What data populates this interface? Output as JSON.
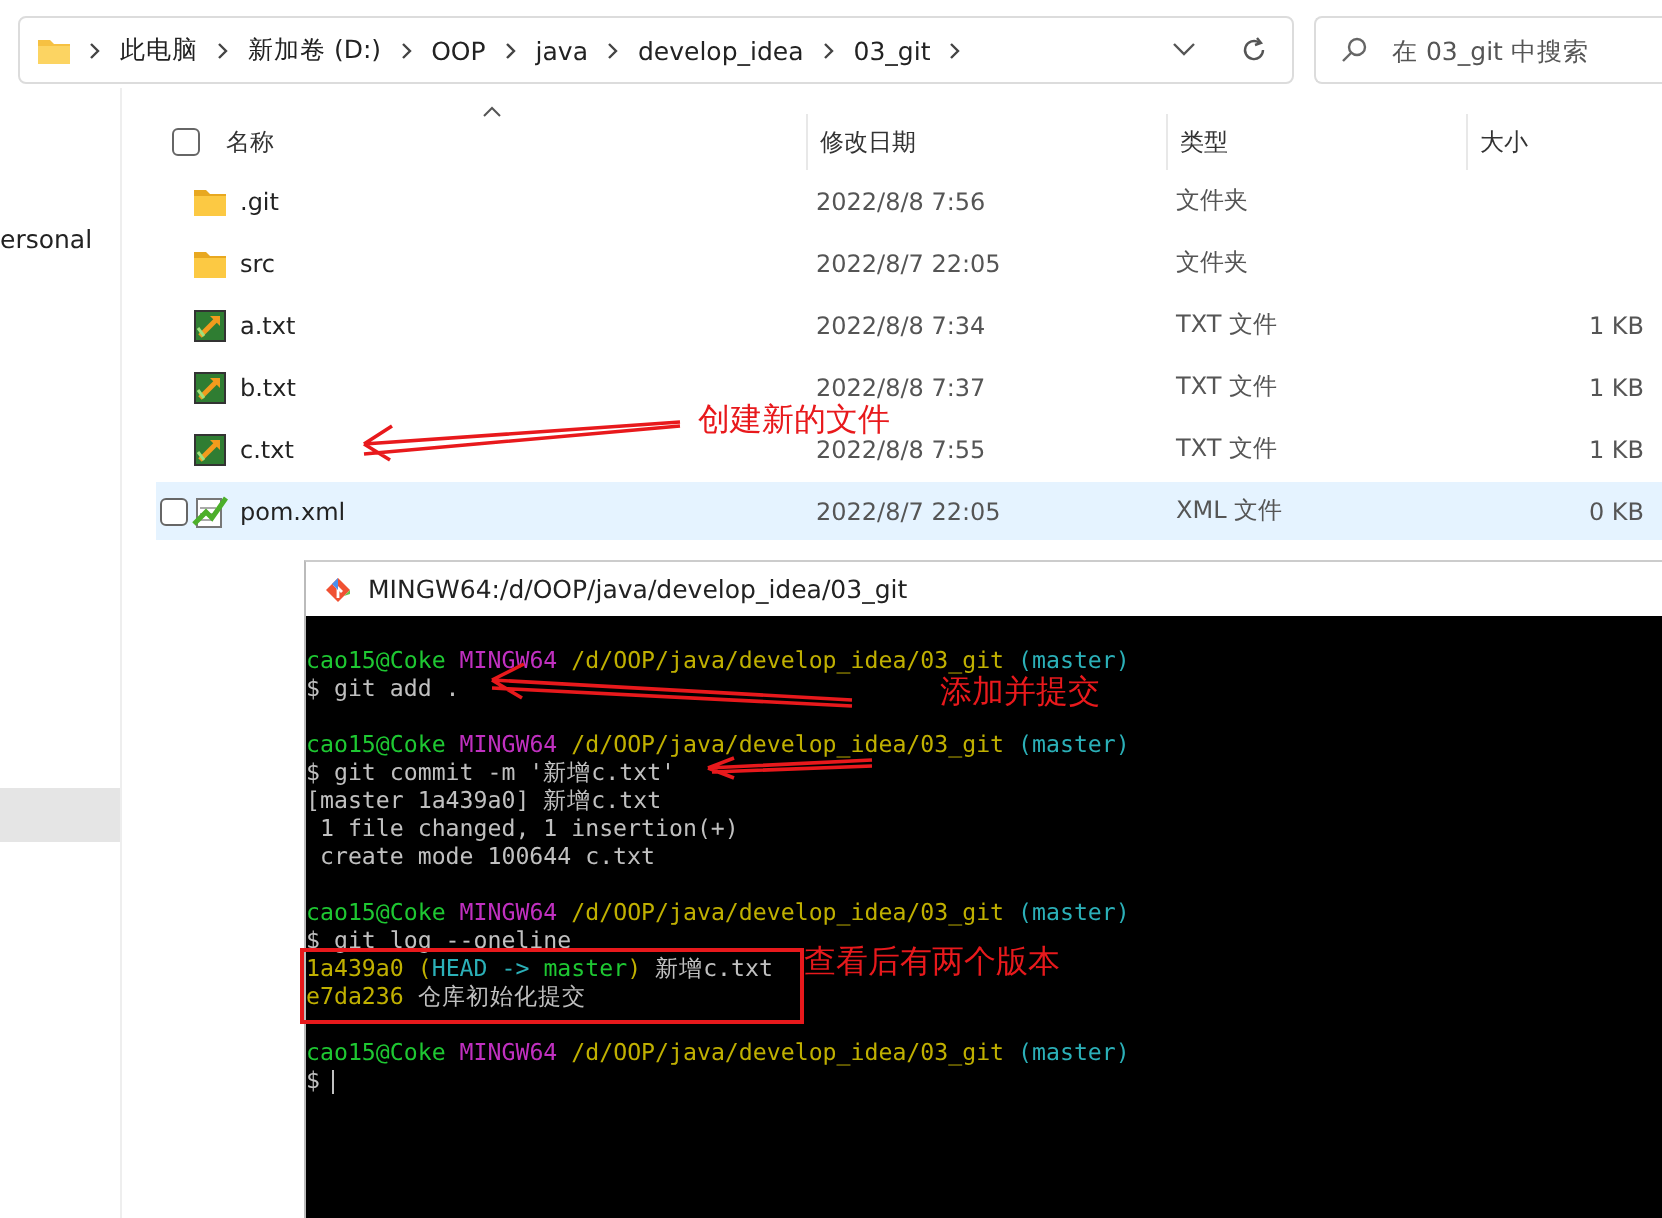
{
  "address_bar": {
    "crumbs": [
      "此电脑",
      "新加卷 (D:)",
      "OOP",
      "java",
      "develop_idea",
      "03_git"
    ]
  },
  "search": {
    "placeholder": "在 03_git 中搜索"
  },
  "nav_pane": {
    "items": [
      {
        "label": "ersonal",
        "selected": false
      },
      {
        "selected": true
      }
    ]
  },
  "file_list": {
    "select_all": {
      "checked": false
    },
    "columns": [
      "名称",
      "修改日期",
      "类型",
      "大小"
    ],
    "rows": [
      {
        "kind": "folder",
        "name": ".git",
        "date": "2022/8/8 7:56",
        "type": "文件夹",
        "hovered": false,
        "checked": false
      },
      {
        "kind": "folder",
        "name": "src",
        "date": "2022/8/7 22:05",
        "type": "文件夹",
        "hovered": false,
        "checked": false
      },
      {
        "kind": "git-file",
        "name": "a.txt",
        "date": "2022/8/8 7:34",
        "type": "TXT 文件",
        "size": "1 KB",
        "hovered": false,
        "checked": false
      },
      {
        "kind": "git-file",
        "name": "b.txt",
        "date": "2022/8/8 7:37",
        "type": "TXT 文件",
        "size": "1 KB",
        "hovered": false,
        "checked": false
      },
      {
        "kind": "git-file",
        "name": "c.txt",
        "date": "2022/8/8 7:55",
        "type": "TXT 文件",
        "size": "1 KB",
        "hovered": false,
        "checked": false
      },
      {
        "kind": "xml-file",
        "name": "pom.xml",
        "date": "2022/8/7 22:05",
        "type": "XML 文件",
        "size": "0 KB",
        "hovered": true,
        "checked": false
      }
    ]
  },
  "terminal": {
    "title": "MINGW64:/d/OOP/java/develop_idea/03_git",
    "lines": [
      {
        "kind": "text",
        "segments": [
          {
            "kind": "user",
            "text": "cao15@Coke"
          },
          {
            "kind": "host",
            "text": "MINGW64"
          },
          {
            "kind": "path",
            "text": "/d/OOP/java/develop_idea/03_git"
          },
          {
            "kind": "branch",
            "text": "(master)"
          }
        ]
      },
      {
        "kind": "text",
        "segments": [
          {
            "kind": "plain",
            "text": "$ git add ."
          }
        ]
      },
      {
        "kind": "blank"
      },
      {
        "kind": "text",
        "segments": [
          {
            "kind": "user",
            "text": "cao15@Coke"
          },
          {
            "kind": "host",
            "text": "MINGW64"
          },
          {
            "kind": "path",
            "text": "/d/OOP/java/develop_idea/03_git"
          },
          {
            "kind": "branch",
            "text": "(master)"
          }
        ]
      },
      {
        "kind": "text",
        "segments": [
          {
            "kind": "plain",
            "text": "$ git commit -m '新增c.txt'"
          }
        ]
      },
      {
        "kind": "text",
        "segments": [
          {
            "kind": "plain",
            "text": "[master 1a439a0] 新增c.txt"
          }
        ]
      },
      {
        "kind": "text",
        "segments": [
          {
            "kind": "plain",
            "text": " 1 file changed, 1 insertion(+)"
          }
        ]
      },
      {
        "kind": "text",
        "segments": [
          {
            "kind": "plain",
            "text": " create mode 100644 c.txt"
          }
        ]
      },
      {
        "kind": "blank"
      },
      {
        "kind": "text",
        "segments": [
          {
            "kind": "user",
            "text": "cao15@Coke"
          },
          {
            "kind": "host",
            "text": "MINGW64"
          },
          {
            "kind": "path",
            "text": "/d/OOP/java/develop_idea/03_git"
          },
          {
            "kind": "branch",
            "text": "(master)"
          }
        ]
      },
      {
        "kind": "text",
        "segments": [
          {
            "kind": "plain",
            "text": "$ git log --oneline"
          }
        ]
      },
      {
        "kind": "text",
        "segments": [
          {
            "kind": "path",
            "text": "1a439a0"
          },
          {
            "kind": "path",
            "text": "("
          },
          {
            "kind": "branch",
            "text": "HEAD ->"
          },
          {
            "kind": "user",
            "text": "master"
          },
          {
            "kind": "path",
            "text": ")"
          },
          {
            "kind": "plain",
            "text": "新增c.txt"
          }
        ]
      },
      {
        "kind": "text",
        "segments": [
          {
            "kind": "path",
            "text": "e7da236"
          },
          {
            "kind": "plain",
            "text": "仓库初始化提交"
          }
        ]
      },
      {
        "kind": "blank"
      },
      {
        "kind": "text",
        "segments": [
          {
            "kind": "user",
            "text": "cao15@Coke"
          },
          {
            "kind": "host",
            "text": "MINGW64"
          },
          {
            "kind": "path",
            "text": "/d/OOP/java/develop_idea/03_git"
          },
          {
            "kind": "branch",
            "text": "(master)"
          }
        ]
      },
      {
        "kind": "text",
        "segments": [
          {
            "kind": "plain",
            "text": "$"
          },
          {
            "kind": "cursor"
          }
        ]
      }
    ]
  },
  "annotations": [
    {
      "text": "创建新的文件"
    },
    {
      "text": "添加并提交"
    },
    {
      "text": "查看后有两个版本"
    }
  ]
}
